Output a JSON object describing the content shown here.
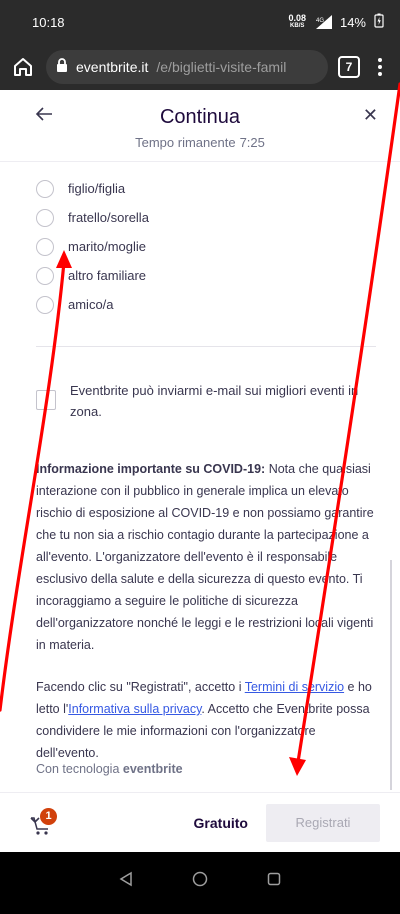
{
  "status_bar": {
    "time": "10:18",
    "net_speed": "0.08",
    "net_unit": "KB/S",
    "network": "4G",
    "battery": "14%"
  },
  "browser": {
    "domain": "eventbrite.it",
    "path": "/e/biglietti-visite-famil",
    "tab_count": "7"
  },
  "modal": {
    "title": "Continua",
    "timer_label": "Tempo rimanente",
    "timer_value": "7:25"
  },
  "relationship_options": [
    "figlio/figlia",
    "fratello/sorella",
    "marito/moglie",
    "altro familiare",
    "amico/a"
  ],
  "marketing_checkbox": "Eventbrite può inviarmi e-mail sui migliori eventi in zona.",
  "covid": {
    "heading": "Informazione importante su COVID-19:",
    "text": "Nota che qualsiasi interazione con il pubblico in generale implica un elevato rischio di esposizione al COVID-19 e non possiamo garantire che tu non sia a rischio contagio durante la partecipazione a all'evento. L'organizzatore dell'evento è il responsabile esclusivo della salute e della sicurezza di questo evento. Ti incoraggiamo a seguire le politiche di sicurezza dell'organizzatore nonché le leggi e le restrizioni locali vigenti in materia."
  },
  "legal": {
    "part1": "Facendo clic su \"Registrati\", accetto i ",
    "terms_link": "Termini di servizio",
    "part2": " e ho letto l'",
    "privacy_link": "Informativa sulla privacy",
    "part3": ". Accetto che Eventbrite possa condividere le mie informazioni con l'organizzatore dell'evento."
  },
  "powered_by": {
    "label": "Con tecnologia",
    "brand": "eventbrite"
  },
  "footer": {
    "cart_count": "1",
    "price": "Gratuito",
    "register_label": "Registrati"
  },
  "colors": {
    "annotation_red": "#ff0000",
    "cart_badge": "#d1410c",
    "link": "#3659e3"
  }
}
